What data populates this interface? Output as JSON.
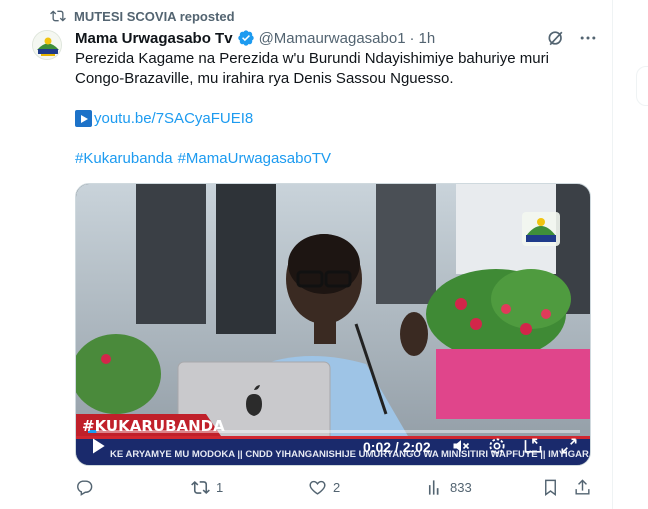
{
  "repost": {
    "label": "MUTESI SCOVIA reposted"
  },
  "tweet": {
    "author_name": "Mama Urwagasabo Tv",
    "handle": "@Mamaurwagasabo1",
    "separator": "·",
    "time": "1h",
    "text": "Perezida Kagame na Perezida w'u Burundi Ndayishimiye bahuriye muri Congo-Brazaville, mu irahira rya Denis Sassou Nguesso.",
    "link": "youtu.be/7SACyaFUEI8",
    "hashtags": [
      "#Kukarubanda",
      "#MamaUrwagasaboTV"
    ]
  },
  "video": {
    "time_display": "0:02 / 2:02",
    "lower_third_title": "#KUKARUBANDA",
    "ticker_text": "KE ARYAMYE MU MODOKA  ||  CNDD YIHANGANISHIJE UMURYANGO WA MINISITIRI WAPFUYE  ||  IMYIGARAGAMBYO",
    "channel_logo_text": "MAMA URWAGASABO TV",
    "progress_fraction": 0.017
  },
  "actions": {
    "reply_count": "",
    "repost_count": "1",
    "like_count": "2",
    "views_count": "833"
  },
  "colors": {
    "accent": "#1d9bf0",
    "muted": "#536471",
    "ticker_red": "#c0202a",
    "ticker_navy": "#1a2a6c"
  }
}
